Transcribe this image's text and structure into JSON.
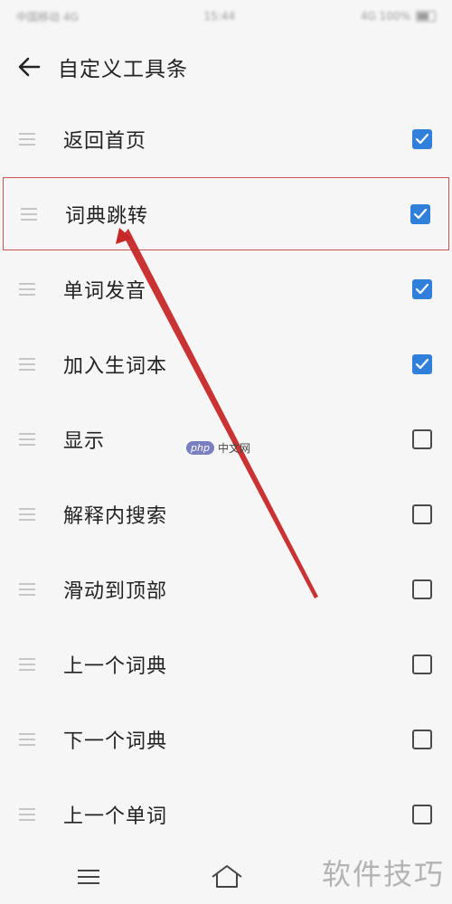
{
  "status_bar": {
    "left": "中国移动 4G",
    "time": "15:44",
    "right": "4G 100%"
  },
  "header": {
    "title": "自定义工具条",
    "back_icon": "arrow-left-icon"
  },
  "items": [
    {
      "label": "返回首页",
      "checked": true
    },
    {
      "label": "词典跳转",
      "checked": true,
      "highlighted": true
    },
    {
      "label": "单词发音",
      "checked": true
    },
    {
      "label": "加入生词本",
      "checked": true
    },
    {
      "label": "显示",
      "checked": false
    },
    {
      "label": "解释内搜索",
      "checked": false
    },
    {
      "label": "滑动到顶部",
      "checked": false
    },
    {
      "label": "上一个词典",
      "checked": false
    },
    {
      "label": "下一个词典",
      "checked": false
    },
    {
      "label": "上一个单词",
      "checked": false
    }
  ],
  "watermark": {
    "badge": "php",
    "text": "中文网"
  },
  "corner_logo": "软件技巧",
  "colors": {
    "accent": "#2f7fdb",
    "highlight_border": "#c8554d",
    "arrow": "#c62828",
    "background": "#f6f6f6"
  }
}
